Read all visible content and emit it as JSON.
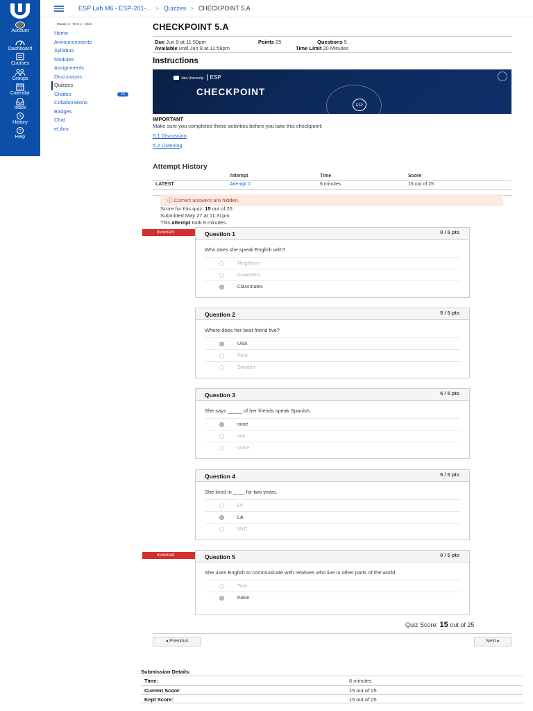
{
  "global_nav": {
    "items": [
      {
        "label": "Account",
        "icon": "avatar-icon"
      },
      {
        "label": "Dashboard",
        "icon": "dashboard-icon"
      },
      {
        "label": "Courses",
        "icon": "courses-icon"
      },
      {
        "label": "Groups",
        "icon": "groups-icon"
      },
      {
        "label": "Calendar",
        "icon": "calendar-icon"
      },
      {
        "label": "Inbox",
        "icon": "inbox-icon"
      },
      {
        "label": "History",
        "icon": "history-icon"
      },
      {
        "label": "Help",
        "icon": "help-icon"
      }
    ],
    "bg_color": "#0b4fa8"
  },
  "breadcrumb": {
    "course": "ESP Lab M6 - ESP-201-...",
    "section": "Quizzes",
    "current": "CHECKPOINT 5.A",
    "separator": ">"
  },
  "course_nav": {
    "term": "Module 3 - Term 1 - 2024",
    "items": [
      {
        "label": "Home"
      },
      {
        "label": "Announcements"
      },
      {
        "label": "Syllabus"
      },
      {
        "label": "Modules"
      },
      {
        "label": "Assignments"
      },
      {
        "label": "Discussions"
      },
      {
        "label": "Quizzes"
      },
      {
        "label": "Grades",
        "badge": "15"
      },
      {
        "label": "Collaborations"
      },
      {
        "label": "Badges"
      },
      {
        "label": "Chat"
      },
      {
        "label": "eLibro"
      }
    ]
  },
  "quiz": {
    "title": "CHECKPOINT 5.A",
    "due_label": "Due",
    "due_value": "Jun 9 at 11:59pm",
    "points_label": "Points",
    "points_value": "25",
    "questions_label": "Questions",
    "questions_value": "5",
    "available_label": "Available",
    "available_value": "until Jun 9 at 11:59pm",
    "time_limit_label": "Time Limit",
    "time_limit_value": "20 Minutes"
  },
  "instructions": {
    "heading": "Instructions",
    "banner_brand": "Jala University",
    "banner_tag": "ESP",
    "banner_title": "CHECKPOINT",
    "banner_badge": "ESP Lab",
    "important": "IMPORTANT",
    "text": "Make sure you completed these activities before you take this checkpoint:",
    "links": [
      "5.1 Discussion",
      "5.2 Listening"
    ]
  },
  "attempt_history": {
    "heading": "Attempt History",
    "columns": [
      "",
      "Attempt",
      "Time",
      "Score"
    ],
    "rows": [
      {
        "label": "LATEST",
        "attempt": "Attempt 1",
        "time": "6 minutes",
        "score": "15 out of 25"
      }
    ]
  },
  "result": {
    "alert": "Correct answers are hidden.",
    "score_line_prefix": "Score for this quiz:",
    "score_value": "15",
    "score_suffix": "out of 25",
    "submitted": "Submitted May 27 at 11:31pm",
    "took_prefix": "This",
    "took_bold": "attempt",
    "took_suffix": "took 6 minutes."
  },
  "questions": [
    {
      "name": "Question 1",
      "points": "0 / 5 pts",
      "incorrect": true,
      "text": "Who does she speak English with?",
      "answers": [
        "Neighbors",
        "Coworkers",
        "Classmates"
      ],
      "selected": 2
    },
    {
      "name": "Question 2",
      "points": "5 / 5 pts",
      "incorrect": false,
      "text": "Where does her best friend live?",
      "answers": [
        "USA",
        "Perú",
        "Sweden"
      ],
      "selected": 0
    },
    {
      "name": "Question 3",
      "points": "5 / 5 pts",
      "incorrect": false,
      "text": "She says _____ of her friends speak Spanish.",
      "answers": [
        "none",
        "one",
        "some"
      ],
      "selected": 0
    },
    {
      "name": "Question 4",
      "points": "5 / 5 pts",
      "incorrect": false,
      "text": " She lived in ____ for two years.",
      "answers": [
        "LV",
        "LA",
        "NYC"
      ],
      "selected": 1
    },
    {
      "name": "Question 5",
      "points": "0 / 5 pts",
      "incorrect": true,
      "text": "She uses English to communicate with relatives who live in other parts of the world.",
      "answers": [
        "True",
        "False"
      ],
      "selected": 1
    }
  ],
  "incorrect_label": "Incorrect",
  "quiz_score": {
    "prefix": "Quiz Score:",
    "value": "15",
    "suffix": "out of 25"
  },
  "pager": {
    "previous": "◂ Previous",
    "next": "Next ▸"
  },
  "submission": {
    "title": "Submission Details:",
    "rows": [
      {
        "label": "Time:",
        "value": "6 minutes"
      },
      {
        "label": "Current Score:",
        "value": "15 out of 25"
      },
      {
        "label": "Kept Score:",
        "value": "15 out of 25"
      }
    ]
  }
}
